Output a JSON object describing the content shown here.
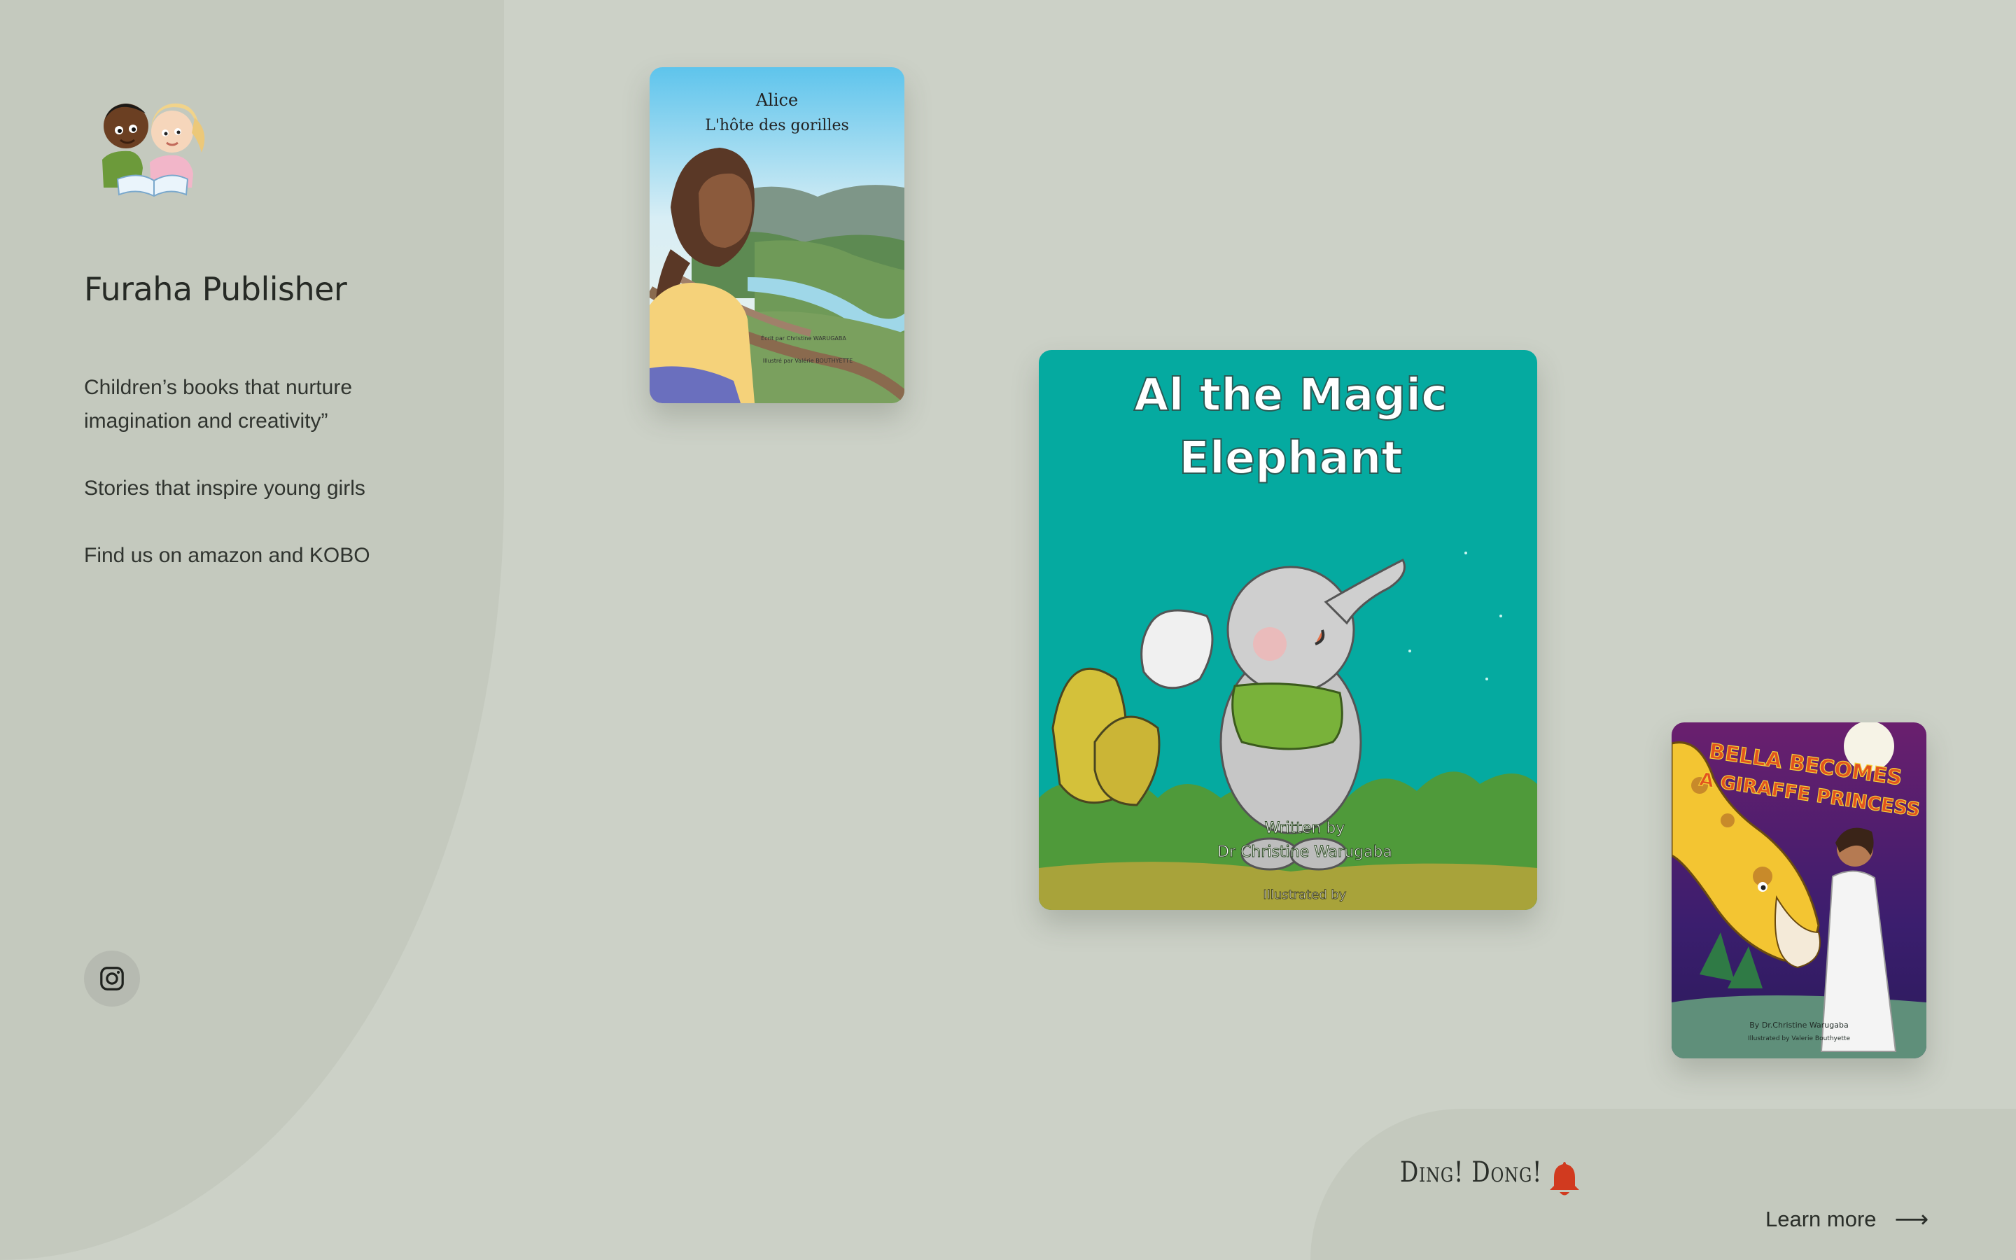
{
  "brand": {
    "name": "Furaha Publisher",
    "logo_icon": "children-reading-logo"
  },
  "taglines": [
    "Children’s books that nurture imagination and creativity”",
    "Stories that inspire young girls",
    "Find us on amazon and KOBO"
  ],
  "social": {
    "instagram_icon": "instagram-icon"
  },
  "books": {
    "alice": {
      "title_line1": "Alice",
      "title_line2": "L'hôte des gorilles",
      "credit_line1": "Écrit par Christine WARUGABA",
      "credit_line2": "Illustré par Valérie BOUTHYETTE"
    },
    "al": {
      "title_line1": "Al the Magic",
      "title_line2": "Elephant",
      "credit_line1": "Written by",
      "credit_line2": "Dr Christine Warugaba",
      "credit_line3": "Illustrated by"
    },
    "bella": {
      "title_line1": "BELLA BECOMES",
      "title_line2": "A GIRAFFE PRINCESS",
      "credit_line1": "By Dr.Christine Warugaba",
      "credit_line2": "Illustrated by Valerie Bouthyette"
    }
  },
  "notice": {
    "text": "Ding! Dong!",
    "bell_icon": "bell-icon",
    "link_label": "Learn more",
    "arrow_icon": "arrow-right-icon"
  },
  "colors": {
    "background": "#ccd1c7",
    "sidebar": "#c4c9be",
    "bell": "#d13a1f",
    "al_cover": "#05aaa0"
  }
}
